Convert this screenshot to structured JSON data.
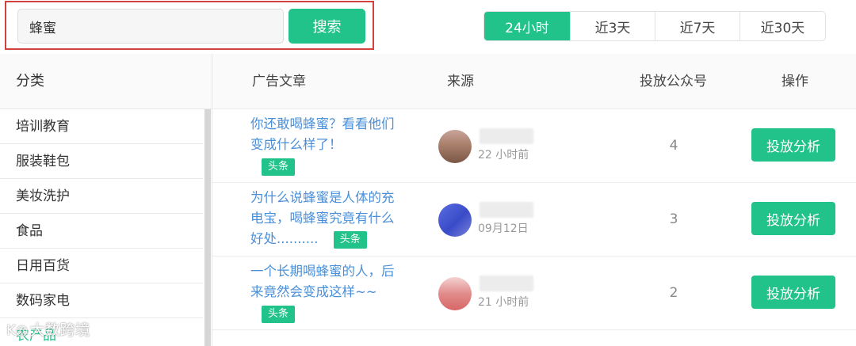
{
  "search": {
    "value": "蜂蜜",
    "button_label": "搜索"
  },
  "time_tabs": [
    {
      "label": "24小时",
      "active": true
    },
    {
      "label": "近3天",
      "active": false
    },
    {
      "label": "近7天",
      "active": false
    },
    {
      "label": "近30天",
      "active": false
    }
  ],
  "sidebar": {
    "header": "分类",
    "items": [
      "培训教育",
      "服装鞋包",
      "美妆洗护",
      "食品",
      "日用百货",
      "数码家电",
      "农产品"
    ]
  },
  "table": {
    "headers": {
      "article": "广告文章",
      "source": "来源",
      "accounts": "投放公众号",
      "action": "操作"
    },
    "rows": [
      {
        "article_title": "你还敢喝蜂蜜？看看他们变成什么样了！",
        "tag": "头条",
        "source_time": "22 小时前",
        "accounts": "4",
        "action_label": "投放分析",
        "avatar_icon": "avatar-image"
      },
      {
        "article_title": "为什么说蜂蜜是人体的充电宝，喝蜂蜜究竟有什么好处..........",
        "tag": "头条",
        "source_time": "09月12日",
        "accounts": "3",
        "action_label": "投放分析",
        "avatar_icon": "avatar-image"
      },
      {
        "article_title": "一个长期喝蜂蜜的人，后来竟然会变成这样~~",
        "tag": "头条",
        "source_time": "21 小时前",
        "accounts": "2",
        "action_label": "投放分析",
        "avatar_icon": "avatar-image"
      }
    ]
  },
  "watermark": {
    "text": "大数跨境",
    "icon": "watermark-logo-icon"
  },
  "colors": {
    "accent": "#22c38a",
    "link": "#4a8fd8",
    "highlight_border": "#d2423f"
  }
}
